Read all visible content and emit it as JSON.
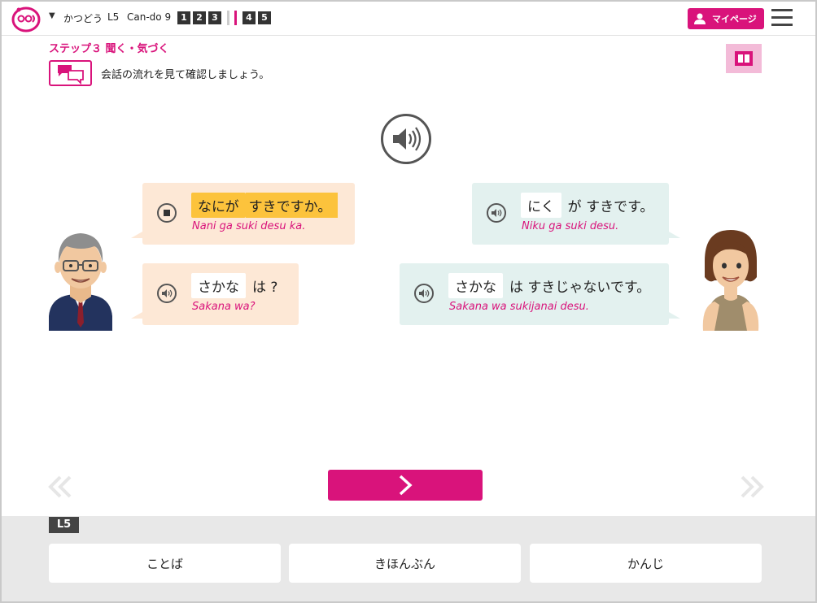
{
  "header": {
    "lesson_label": "かつどう",
    "lesson_code": "L5",
    "cando": "Can-do 9",
    "steps_left": [
      "1",
      "2",
      "3"
    ],
    "steps_right": [
      "4",
      "5"
    ],
    "mypage_label": "マイページ",
    "accent": "#d9137b"
  },
  "step": {
    "title": "ステップ３ 聞く・気づく",
    "instruction": "会話の流れを見て確認しましょう。"
  },
  "dialogue": [
    {
      "speaker": "man",
      "word": "なにが",
      "rest": "すきですか。",
      "romaji": "Nani ga suki desu ka.",
      "highlighted": true,
      "playing": true
    },
    {
      "speaker": "woman",
      "word": "にく",
      "rest": "が すきです。",
      "romaji": "Niku ga suki desu.",
      "highlighted": false,
      "playing": false
    },
    {
      "speaker": "man",
      "word": "さかな",
      "rest": "は ?",
      "romaji": "Sakana wa?",
      "highlighted": false,
      "playing": false
    },
    {
      "speaker": "woman",
      "word": "さかな",
      "rest": "は すきじゃないです。",
      "romaji": "Sakana wa sukijanai desu.",
      "highlighted": false,
      "playing": false
    }
  ],
  "footer": {
    "lesson_tag": "L5",
    "buttons": [
      "ことば",
      "きほんぶん",
      "かんじ"
    ]
  }
}
